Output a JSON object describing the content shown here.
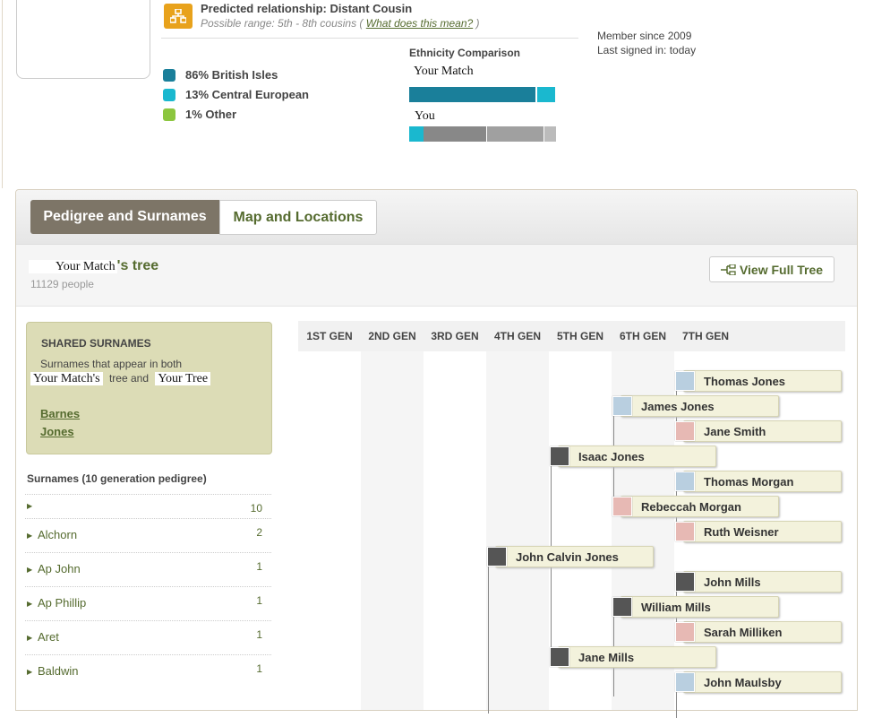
{
  "relationship": {
    "title": "Predicted relationship: Distant Cousin",
    "range_text": "Possible range: 5th - 8th cousins (",
    "range_link": "What does this mean?",
    "range_close": ")"
  },
  "ethnicity": [
    {
      "label": "86% British Isles",
      "color": "#1a7f9a"
    },
    {
      "label": "13% Central European",
      "color": "#1ab8cf"
    },
    {
      "label": "1% Other",
      "color": "#8cc63f"
    }
  ],
  "comparison": {
    "title": "Ethnicity Comparison",
    "match_label": "Your Match",
    "you_label": "You"
  },
  "member": {
    "since": "Member since 2009",
    "signed_in": "Last signed in: today"
  },
  "tabs": {
    "pedigree": "Pedigree and Surnames",
    "map": "Map and Locations"
  },
  "tree": {
    "owner": "Your Match",
    "suffix": "'s tree",
    "count": "11129 people",
    "view_full": "View Full Tree"
  },
  "shared": {
    "title": "SHARED SURNAMES",
    "line1": "Surnames that appear in both",
    "match_tree": "Your Match's",
    "and": "tree and",
    "your_tree": "Your Tree",
    "links": [
      "Barnes",
      "Jones"
    ]
  },
  "surnames": {
    "title": "Surnames (10 generation pedigree)",
    "rows": [
      {
        "name": "",
        "count": "10"
      },
      {
        "name": "Alchorn",
        "count": "2"
      },
      {
        "name": "Ap John",
        "count": "1"
      },
      {
        "name": "Ap Phillip",
        "count": "1"
      },
      {
        "name": "Aret",
        "count": "1"
      },
      {
        "name": "Baldwin",
        "count": "1"
      }
    ]
  },
  "generations": [
    "1ST GEN",
    "2ND GEN",
    "3RD GEN",
    "4TH GEN",
    "5TH GEN",
    "6TH GEN",
    "7TH GEN"
  ],
  "people": {
    "thomas_jones": "Thomas Jones",
    "james_jones": "James Jones",
    "jane_smith": "Jane Smith",
    "isaac_jones": "Isaac Jones",
    "thomas_morgan": "Thomas Morgan",
    "rebeccah_morgan": "Rebeccah Morgan",
    "ruth_weisner": "Ruth Weisner",
    "john_calvin_jones": "John Calvin Jones",
    "john_mills": "John Mills",
    "william_mills": "William Mills",
    "sarah_milliken": "Sarah Milliken",
    "jane_mills": "Jane Mills",
    "john_maulsby": "John Maulsby"
  }
}
